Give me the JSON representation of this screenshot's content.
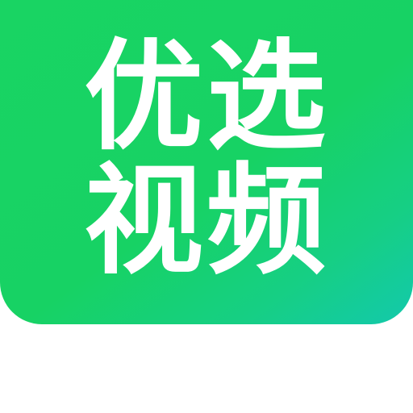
{
  "logo": {
    "line1": "优选",
    "line2": "视频",
    "colors": {
      "background_start": "#19d463",
      "background_end": "#13c9ac",
      "text": "#ffffff",
      "page": "#ffffff"
    }
  }
}
